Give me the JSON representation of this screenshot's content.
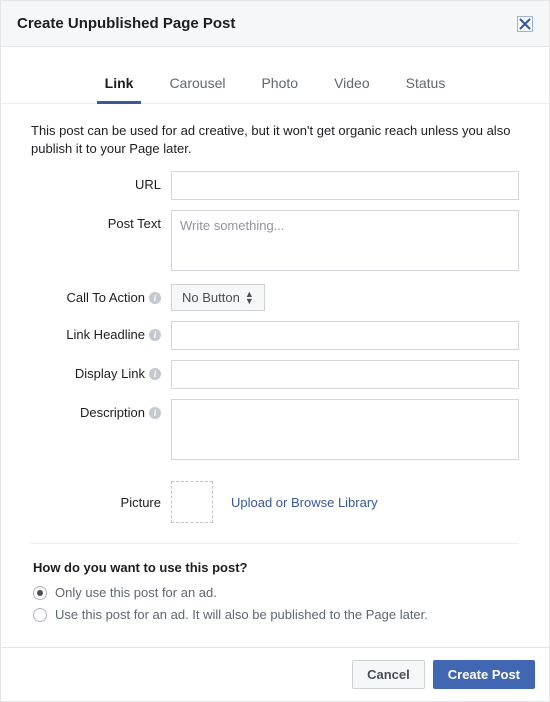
{
  "header": {
    "title": "Create Unpublished Page Post"
  },
  "tabs": [
    {
      "label": "Link",
      "active": true
    },
    {
      "label": "Carousel",
      "active": false
    },
    {
      "label": "Photo",
      "active": false
    },
    {
      "label": "Video",
      "active": false
    },
    {
      "label": "Status",
      "active": false
    }
  ],
  "info_text": "This post can be used for ad creative, but it won't get organic reach unless you also publish it to your Page later.",
  "form": {
    "url_label": "URL",
    "post_text_label": "Post Text",
    "post_text_placeholder": "Write something...",
    "cta_label": "Call To Action",
    "cta_value": "No Button",
    "link_headline_label": "Link Headline",
    "display_link_label": "Display Link",
    "description_label": "Description",
    "picture_label": "Picture",
    "upload_label": "Upload or Browse Library"
  },
  "usage": {
    "heading": "How do you want to use this post?",
    "options": [
      {
        "label": "Only use this post for an ad.",
        "checked": true
      },
      {
        "label": "Use this post for an ad. It will also be published to the Page later.",
        "checked": false
      }
    ]
  },
  "footer": {
    "cancel_label": "Cancel",
    "create_label": "Create Post"
  }
}
